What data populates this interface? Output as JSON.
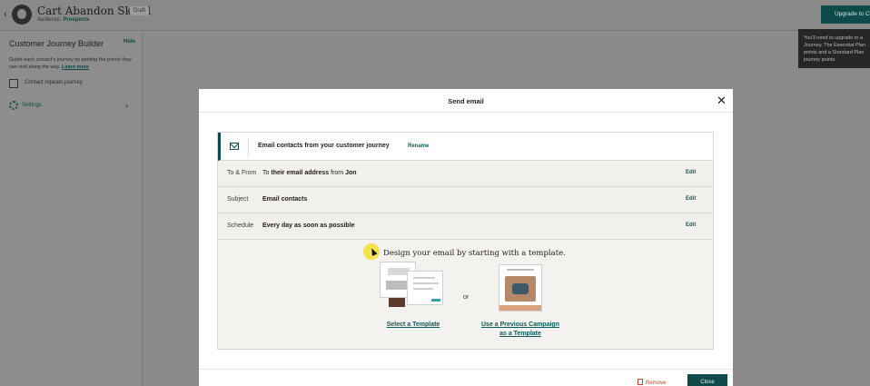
{
  "header": {
    "title": "Cart Abandon Skin 1",
    "draft_badge": "Draft",
    "audience_label": "Audience:",
    "audience_value": "Prospects",
    "upgrade_button": "Upgrade to Co",
    "tooltip_text": "You'll need to upgrade to a\nJourney. The Essential Plan\npoints and a Standard Plan\njourney points."
  },
  "sidebar": {
    "title": "Customer Journey Builder",
    "hide": "Hide",
    "description": "Guide each contact's journey by plotting the points they can visit along the way.",
    "learn_more": "Learn more",
    "checkbox_label": "Contact repeats journey",
    "settings": "Settings"
  },
  "modal": {
    "title": "Send email",
    "head_title": "Email contacts from your customer journey",
    "rename": "Rename",
    "rows": [
      {
        "label": "To & From",
        "value_prefix": "To",
        "value_main": "their email address",
        "value_mid": "from",
        "value_end": "Jon",
        "edit": "Edit"
      },
      {
        "label": "Subject",
        "value_main": "Email contacts",
        "edit": "Edit"
      },
      {
        "label": "Schedule",
        "value_main": "Every day as soon as possible",
        "edit": "Edit"
      }
    ],
    "design_heading": "Design your email by starting with a template.",
    "or": "or",
    "select_template": "Select a Template",
    "prev_campaign_line1": "Use a Previous Campaign",
    "prev_campaign_line2": "as a Template",
    "remove": "Remove",
    "close": "Close"
  },
  "colors": {
    "accent": "#0f4a4a",
    "remove": "#c0472e",
    "highlight": "#f4e24a"
  }
}
